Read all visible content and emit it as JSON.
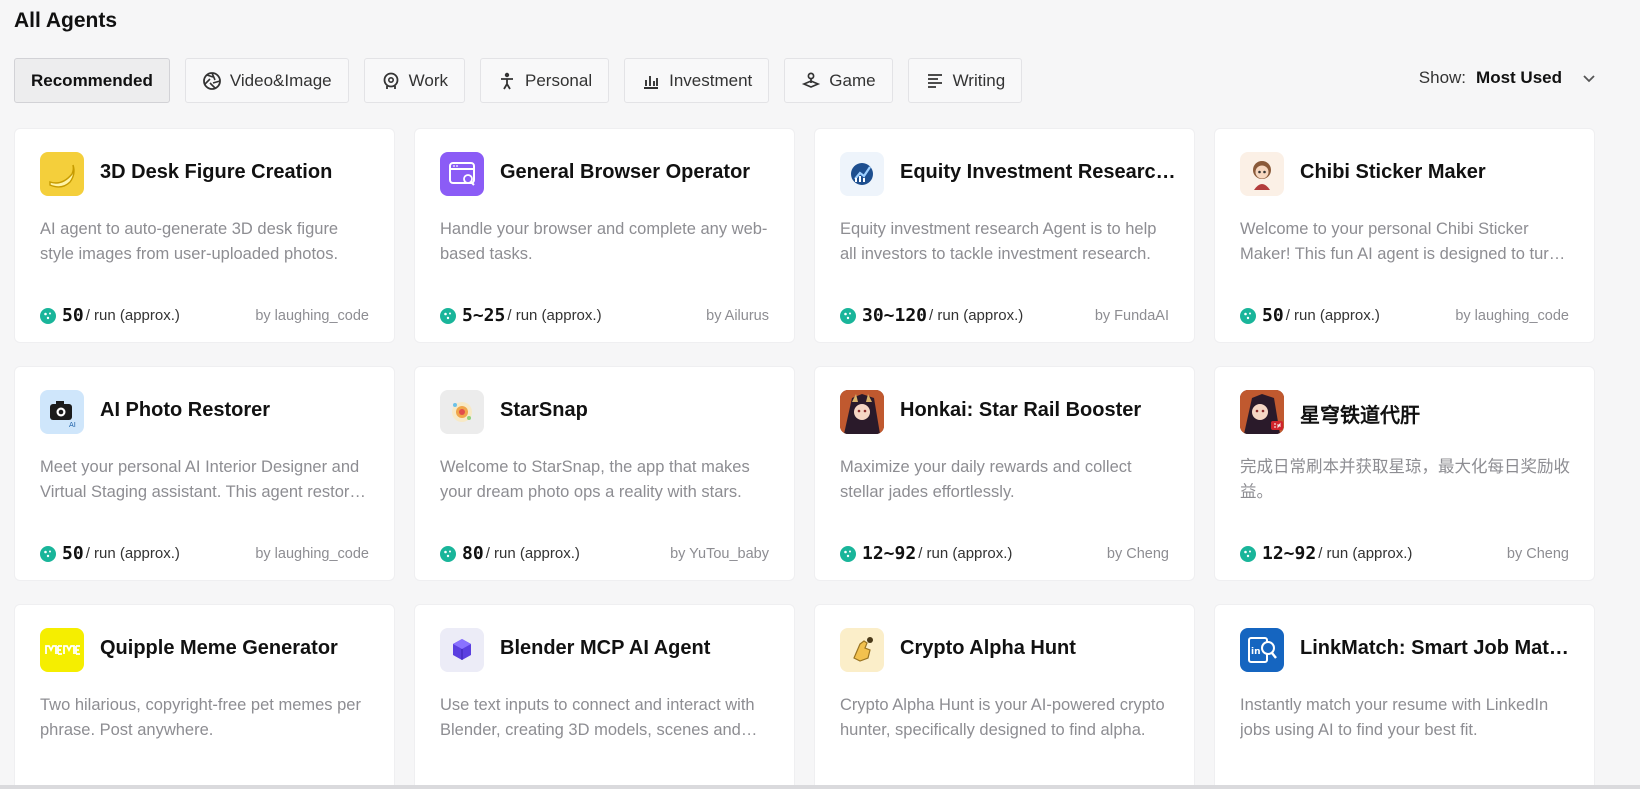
{
  "page": {
    "title": "All Agents"
  },
  "tabs": [
    {
      "label": "Recommended",
      "icon": "",
      "active": true
    },
    {
      "label": "Video&Image",
      "icon": "aperture-icon"
    },
    {
      "label": "Work",
      "icon": "briefcase-gear-icon"
    },
    {
      "label": "Personal",
      "icon": "person-icon"
    },
    {
      "label": "Investment",
      "icon": "bar-chart-icon"
    },
    {
      "label": "Game",
      "icon": "joystick-icon"
    },
    {
      "label": "Writing",
      "icon": "text-lines-icon"
    }
  ],
  "sort": {
    "label": "Show:",
    "value": "Most Used"
  },
  "cards": [
    {
      "title": "3D Desk Figure Creation",
      "description": "AI agent to auto-generate 3D desk figure style images from user-uploaded photos.",
      "price": "50",
      "unit": "/ run (approx.)",
      "author": "by laughing_code",
      "icon": "banana-icon",
      "icon_bg": "#f4cf3b"
    },
    {
      "title": "General Browser Operator",
      "description": "Handle your browser and complete any web-based tasks.",
      "price": "5~25",
      "unit": "/ run (approx.)",
      "author": "by Ailurus",
      "icon": "browser-window-icon",
      "icon_bg": "#8b5cf6"
    },
    {
      "title": "Equity Investment Research Agent",
      "description": "Equity investment research Agent is to help all investors to tackle investment research.",
      "price": "30~120",
      "unit": "/ run (approx.)",
      "author": "by FundaAI",
      "icon": "globe-chart-icon",
      "icon_bg": "#eef4fb"
    },
    {
      "title": "Chibi Sticker Maker",
      "description": "Welcome to your personal Chibi Sticker Maker! This fun AI agent is designed to turn your photos into stickers.",
      "price": "50",
      "unit": "/ run (approx.)",
      "author": "by laughing_code",
      "icon": "chibi-avatar-icon",
      "icon_bg": "#fbf0e6"
    },
    {
      "title": "AI Photo Restorer",
      "description": "Meet your personal AI Interior Designer and Virtual Staging assistant. This agent restores your photos.",
      "price": "50",
      "unit": "/ run (approx.)",
      "author": "by laughing_code",
      "icon": "camera-ai-icon",
      "icon_bg": "#cfe6fb"
    },
    {
      "title": "StarSnap",
      "description": "Welcome to StarSnap, the app that makes your dream photo ops a reality with stars.",
      "price": "80",
      "unit": "/ run (approx.)",
      "author": "by YuTou_baby",
      "icon": "starsnap-icon",
      "icon_bg": "#ececec"
    },
    {
      "title": "Honkai: Star Rail Booster",
      "description": "Maximize your daily rewards and collect stellar jades effortlessly.",
      "price": "12~92",
      "unit": "/ run (approx.)",
      "author": "by Cheng",
      "icon": "game-character-icon",
      "icon_bg": "#7a3a2a"
    },
    {
      "title": "星穹铁道代肝",
      "description": "完成日常刷本并获取星琼，最大化每日奖励收益。",
      "price": "12~92",
      "unit": "/ run (approx.)",
      "author": "by Cheng",
      "icon": "game-character-cn-icon",
      "icon_bg": "#7a3a2a"
    },
    {
      "title": "Quipple Meme Generator",
      "description": "Two hilarious, copyright-free pet memes per phrase. Post anywhere.",
      "price": "",
      "unit": "",
      "author": "",
      "icon": "meme-logo-icon",
      "icon_bg": "#f5ee00"
    },
    {
      "title": "Blender MCP AI Agent",
      "description": "Use text inputs to connect and interact with Blender, creating 3D models, scenes and more.",
      "price": "",
      "unit": "",
      "author": "",
      "icon": "cube-icon",
      "icon_bg": "#ececf7"
    },
    {
      "title": "Crypto Alpha Hunt",
      "description": "Crypto Alpha Hunt is your AI-powered crypto hunter, specifically designed to find alpha.",
      "price": "",
      "unit": "",
      "author": "",
      "icon": "hand-pointer-icon",
      "icon_bg": "#fbeec9"
    },
    {
      "title": "LinkMatch: Smart Job Matcher",
      "description": "Instantly match your resume with LinkedIn jobs using AI to find your best fit.",
      "price": "",
      "unit": "",
      "author": "",
      "icon": "linkedin-search-icon",
      "icon_bg": "#1565c0"
    }
  ]
}
